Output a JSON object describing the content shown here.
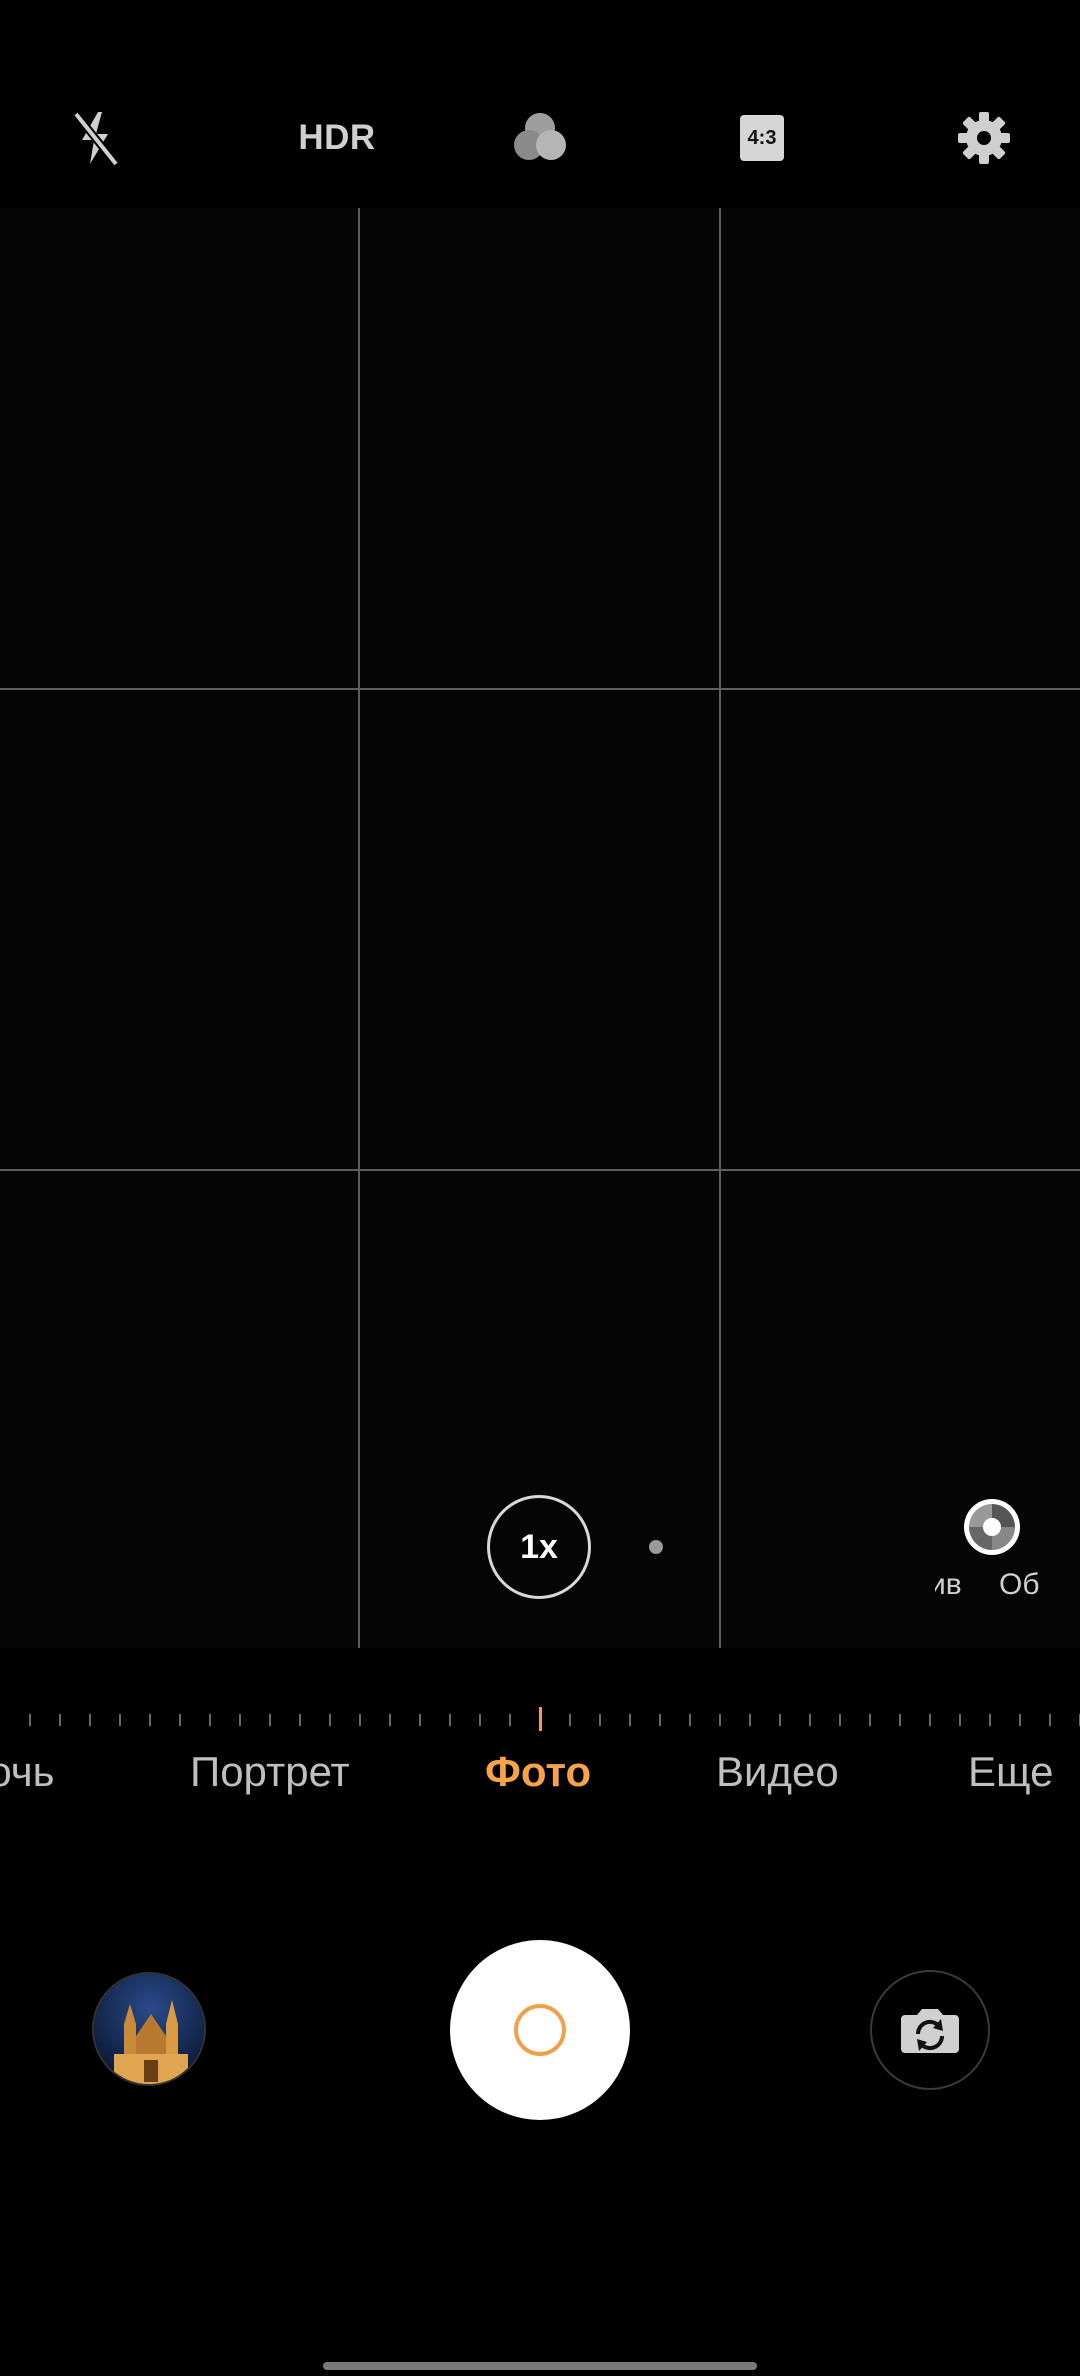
{
  "top_bar": {
    "flash_icon": "flash-off-icon",
    "hdr_label": "HDR",
    "filter_icon": "filters-icon",
    "aspect_ratio_label": "4:3",
    "settings_icon": "gear-icon"
  },
  "viewfinder": {
    "zoom_label": "1x",
    "aperture_icon": "aperture-icon",
    "aperture_labels": [
      "ив",
      "Об"
    ]
  },
  "modes": [
    {
      "label": "Ночь",
      "active": false
    },
    {
      "label": "Портрет",
      "active": false
    },
    {
      "label": "Фото",
      "active": true
    },
    {
      "label": "Видео",
      "active": false
    },
    {
      "label": "Еще",
      "active": false
    }
  ],
  "bottom_bar": {
    "gallery_icon": "gallery-thumbnail",
    "shutter_icon": "shutter-button",
    "switch_camera_icon": "switch-camera-icon"
  },
  "colors": {
    "accent": "#f5a24a",
    "background": "#000000",
    "grid_lines": "#5e5e5e"
  }
}
